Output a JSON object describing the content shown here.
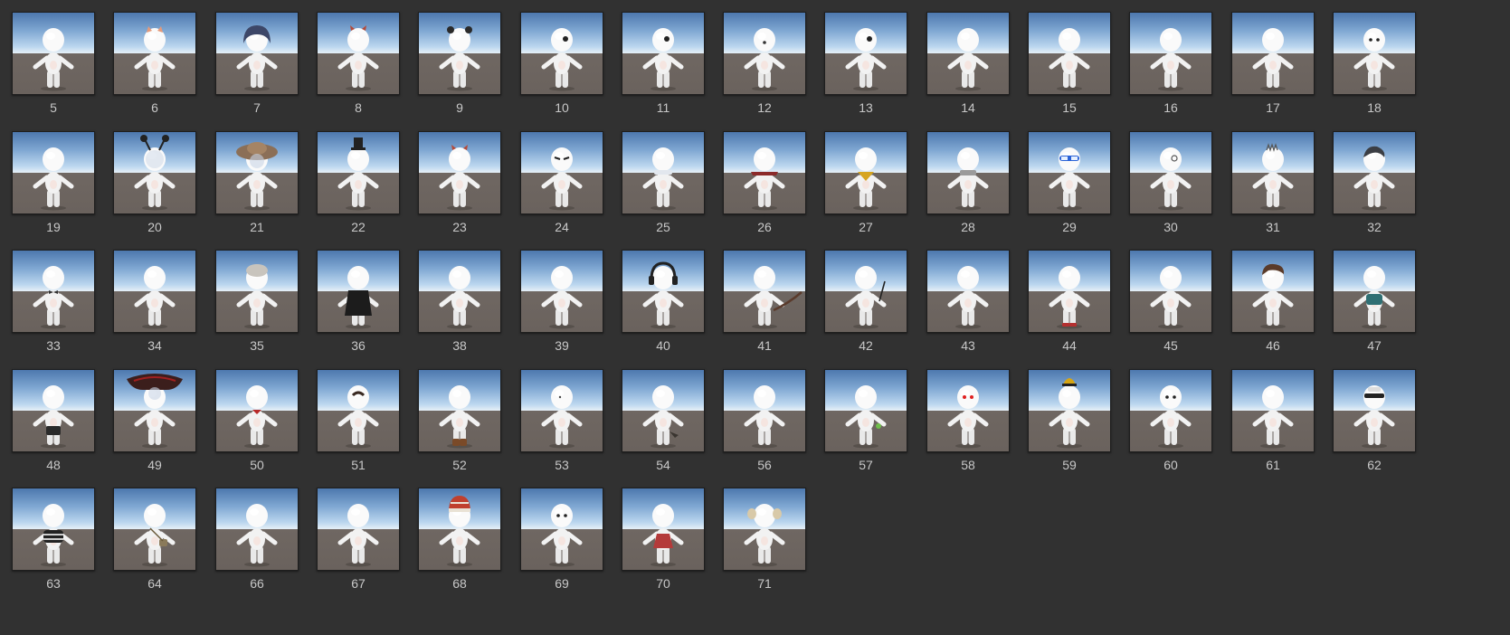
{
  "assets": [
    {
      "label": "5",
      "accessory": "none"
    },
    {
      "label": "6",
      "accessory": "cat-ears"
    },
    {
      "label": "7",
      "accessory": "hood"
    },
    {
      "label": "8",
      "accessory": "horns-small"
    },
    {
      "label": "9",
      "accessory": "panda-ears"
    },
    {
      "label": "10",
      "accessory": "eyepatch"
    },
    {
      "label": "11",
      "accessory": "eyepatch"
    },
    {
      "label": "12",
      "accessory": "nose-dot"
    },
    {
      "label": "13",
      "accessory": "eyepatch"
    },
    {
      "label": "14",
      "accessory": "none"
    },
    {
      "label": "15",
      "accessory": "none"
    },
    {
      "label": "16",
      "accessory": "none"
    },
    {
      "label": "17",
      "accessory": "none"
    },
    {
      "label": "18",
      "accessory": "eyes"
    },
    {
      "label": "19",
      "accessory": "none"
    },
    {
      "label": "20",
      "accessory": "antennae"
    },
    {
      "label": "21",
      "accessory": "straw-hat"
    },
    {
      "label": "22",
      "accessory": "top-hat"
    },
    {
      "label": "23",
      "accessory": "horns-small"
    },
    {
      "label": "24",
      "accessory": "angry-eyes"
    },
    {
      "label": "25",
      "accessory": "scarf-white"
    },
    {
      "label": "26",
      "accessory": "cape-red"
    },
    {
      "label": "27",
      "accessory": "bandana-yellow"
    },
    {
      "label": "28",
      "accessory": "scarf-grey"
    },
    {
      "label": "29",
      "accessory": "sunglasses-blue"
    },
    {
      "label": "30",
      "accessory": "monocle"
    },
    {
      "label": "31",
      "accessory": "spikes"
    },
    {
      "label": "32",
      "accessory": "hair-dark"
    },
    {
      "label": "33",
      "accessory": "bowtie"
    },
    {
      "label": "34",
      "accessory": "none"
    },
    {
      "label": "35",
      "accessory": "bandage-head"
    },
    {
      "label": "36",
      "accessory": "robe-black"
    },
    {
      "label": "38",
      "accessory": "none"
    },
    {
      "label": "39",
      "accessory": "none"
    },
    {
      "label": "40",
      "accessory": "headphones"
    },
    {
      "label": "41",
      "accessory": "tail"
    },
    {
      "label": "42",
      "accessory": "wand"
    },
    {
      "label": "43",
      "accessory": "none"
    },
    {
      "label": "44",
      "accessory": "shoes-red"
    },
    {
      "label": "45",
      "accessory": "none"
    },
    {
      "label": "46",
      "accessory": "hair-brown"
    },
    {
      "label": "47",
      "accessory": "shirt-teal"
    },
    {
      "label": "48",
      "accessory": "shorts-black"
    },
    {
      "label": "49",
      "accessory": "sombrero"
    },
    {
      "label": "50",
      "accessory": "collar-red"
    },
    {
      "label": "51",
      "accessory": "mustache"
    },
    {
      "label": "52",
      "accessory": "boots-brown"
    },
    {
      "label": "53",
      "accessory": "small-eye"
    },
    {
      "label": "54",
      "accessory": "tail-dark"
    },
    {
      "label": "56",
      "accessory": "none"
    },
    {
      "label": "57",
      "accessory": "potion-green"
    },
    {
      "label": "58",
      "accessory": "red-eyes"
    },
    {
      "label": "59",
      "accessory": "bell-hat"
    },
    {
      "label": "60",
      "accessory": "eyes"
    },
    {
      "label": "61",
      "accessory": "none"
    },
    {
      "label": "62",
      "accessory": "glasses-black"
    },
    {
      "label": "63",
      "accessory": "striped-shirt"
    },
    {
      "label": "64",
      "accessory": "satchel"
    },
    {
      "label": "66",
      "accessory": "none"
    },
    {
      "label": "67",
      "accessory": "none"
    },
    {
      "label": "68",
      "accessory": "beanie-red"
    },
    {
      "label": "69",
      "accessory": "eyes"
    },
    {
      "label": "70",
      "accessory": "dress-red"
    },
    {
      "label": "71",
      "accessory": "monkey-ears"
    }
  ],
  "colors": {
    "background": "#313131",
    "label": "#c8c8c8",
    "sky_top": "#4d78ae",
    "sky_horizon": "#e6f0f7",
    "ground": "#6c645f",
    "body": "#f2f2f2"
  }
}
